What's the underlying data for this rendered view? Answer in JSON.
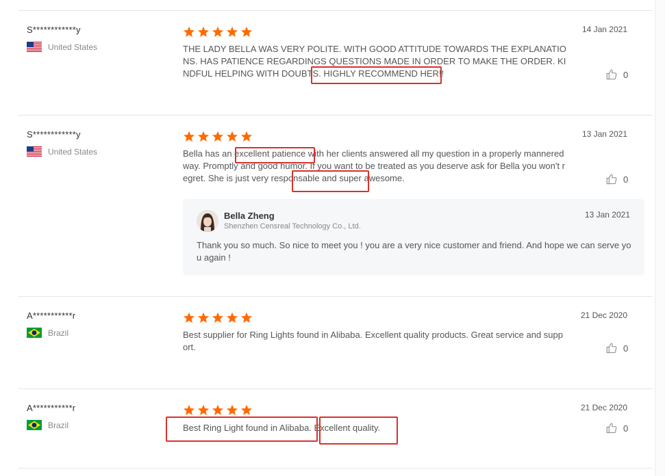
{
  "reviews": [
    {
      "name": "S************y",
      "country": "United States",
      "flag": "us-flag",
      "rating": 5,
      "date": "14 Jan 2021",
      "text": "THE LADY BELLA WAS VERY POLITE. WITH GOOD ATTITUDE TOWARDS THE EXPLANATIONS. HAS PATIENCE REGARDINGS QUESTIONS MADE IN ORDER TO MAKE THE ORDER. KINDFUL HELPING WITH DOUBTS. HIGHLY RECOMMEND HER!!",
      "likes": "0"
    },
    {
      "name": "S************y",
      "country": "United States",
      "flag": "us-flag",
      "rating": 5,
      "date": "13 Jan 2021",
      "text": "Bella has an excellent patience with her clients answered all my question in a properly mannered way. Promptly and good humor. If you want to be treated as you deserve ask for Bella you won't regret. She is just very responsable and super awesome.",
      "likes": "0",
      "reply": {
        "name": "Bella Zheng",
        "company": "Shenzhen Censreal Technology Co., Ltd.",
        "date": "13 Jan 2021",
        "text": "Thank you so much. So nice to meet you !  you are a very nice customer and friend. And hope we can serve you again !"
      }
    },
    {
      "name": "A***********r",
      "country": "Brazil",
      "flag": "brazil-flag",
      "rating": 5,
      "date": "21 Dec 2020",
      "text": "Best supplier for Ring Lights found in Alibaba. Excellent quality products. Great service and support.",
      "likes": "0"
    },
    {
      "name": "A***********r",
      "country": "Brazil",
      "flag": "brazil-flag",
      "rating": 5,
      "date": "21 Dec 2020",
      "text": "Best Ring Light found in Alibaba. Excellent quality.",
      "likes": "0"
    }
  ],
  "colors": {
    "star": "#ff6a00",
    "highlight": "#d9302a",
    "divider": "#e6e6e6"
  },
  "icons": {
    "like": "thumbs-up-icon",
    "star": "star-icon"
  }
}
